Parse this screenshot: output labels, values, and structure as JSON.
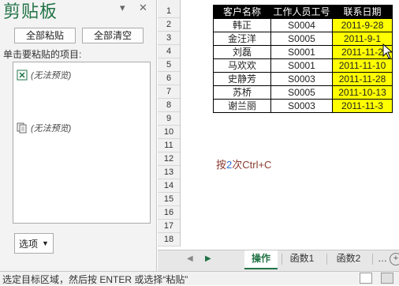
{
  "clipboard": {
    "title": "剪贴板",
    "dropdown_icon": "▾",
    "close_icon": "✕",
    "paste_all_label": "全部粘贴",
    "clear_all_label": "全部清空",
    "hint": "单击要粘贴的项目:",
    "items": [
      {
        "icon": "excel-clip-icon",
        "text": "(无法预览)"
      },
      {
        "icon": "copy-clip-icon",
        "text": "(无法预览)"
      }
    ],
    "options_label": "选项"
  },
  "sheet": {
    "row_numbers": [
      "1",
      "2",
      "3",
      "4",
      "5",
      "6",
      "7",
      "8",
      "9",
      "10",
      "11",
      "12",
      "13",
      "14",
      "15",
      "16",
      "17",
      "18"
    ],
    "headers": [
      "客户名称",
      "工作人员工号",
      "联系日期"
    ],
    "rows": [
      [
        "韩正",
        "S0004",
        "2011-9-28"
      ],
      [
        "金汪洋",
        "S0005",
        "2011-9-1"
      ],
      [
        "刘磊",
        "S0001",
        "2011-11-2"
      ],
      [
        "马欢欢",
        "S0001",
        "2011-11-10"
      ],
      [
        "史静芳",
        "S0003",
        "2011-11-28"
      ],
      [
        "苏桥",
        "S0005",
        "2011-10-13"
      ],
      [
        "谢兰丽",
        "S0003",
        "2011-11-3"
      ]
    ],
    "note_prefix": "按",
    "note_number": "2",
    "note_suffix": "次Ctrl+C",
    "highlight_color": "#ffff00"
  },
  "tabs": {
    "items": [
      "操作",
      "函数1",
      "函数2"
    ],
    "active": "操作",
    "add_icon": "+"
  },
  "status": {
    "text": "选定目标区域，然后按 ENTER 或选择“粘贴”"
  }
}
